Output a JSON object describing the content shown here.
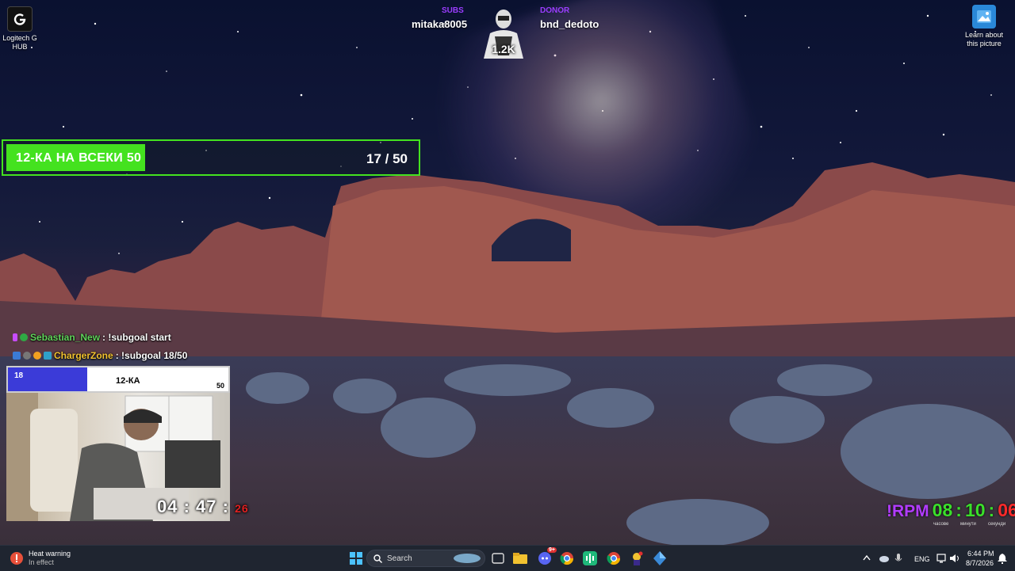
{
  "desktop": {
    "icons": [
      {
        "label": "Logitech G HUB",
        "icon": "logitech-g-hub-icon"
      },
      {
        "label": "Learn about this picture",
        "icon": "spotlight-picture-icon"
      }
    ]
  },
  "alert": {
    "left_tag": "SUBS",
    "left_user": "mitaka8005",
    "right_tag": "DONOR",
    "right_user": "bnd_dedoto",
    "count": "1.2K"
  },
  "subgoal_bar": {
    "label": "12-КА НА ВСЕКИ 50",
    "current": 17,
    "target": 50,
    "progress_text": "17 / 50",
    "fill_fraction": 0.34,
    "colors": {
      "accent": "#44e21f"
    }
  },
  "chat": [
    {
      "user": "Sebastian_New",
      "message": ": !subgoal start",
      "user_color": "#5fd35a"
    },
    {
      "user": "ChargerZone",
      "message": ": !subgoal 18/50",
      "user_color": "#f2c230"
    }
  ],
  "small_goal": {
    "current": "18",
    "title": "12-КА",
    "max": "50",
    "fill_fraction": 0.36
  },
  "webcam": {
    "timer_main": "04 : 47 :",
    "timer_seconds": "26"
  },
  "clock_widget": {
    "prefix": "!RPM",
    "hours": "08",
    "minutes": "10",
    "seconds": "06",
    "captions": [
      "часове",
      "минути",
      "секунди"
    ]
  },
  "taskbar": {
    "weather_title": "Heat warning",
    "weather_sub": "In effect",
    "search_placeholder": "Search",
    "language": "ENG",
    "time": "6:44 PM",
    "date": "8/7/2026",
    "pinned": [
      "windows-start-icon",
      "search-icon",
      "task-view-icon",
      "file-explorer-icon",
      "discord-icon",
      "chrome-icon",
      "audio-app-icon",
      "chrome-profile-icon",
      "streamer-app-icon",
      "crystal-app-icon"
    ],
    "discord_badge": "9+"
  }
}
